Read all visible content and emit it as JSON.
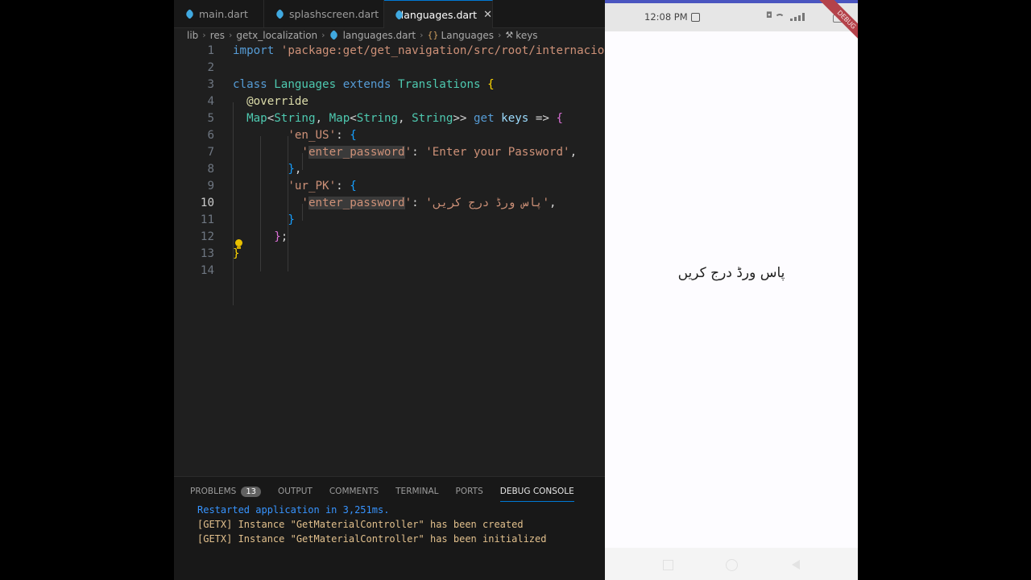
{
  "editor": {
    "tabs": [
      {
        "label": "main.dart",
        "active": false
      },
      {
        "label": "splashscreen.dart",
        "active": false
      },
      {
        "label": "languages.dart",
        "active": true
      }
    ],
    "close_glyph": "✕",
    "breadcrumbs": [
      "lib",
      "res",
      "getx_localization",
      "languages.dart",
      "Languages",
      "keys"
    ],
    "current_line": 10,
    "lines": [
      {
        "n": "1",
        "tokens": [
          [
            "kw",
            "import"
          ],
          [
            "pl",
            " "
          ],
          [
            "str",
            "'package:get/get_navigation/src/root/internacionalization.dart';"
          ]
        ]
      },
      {
        "n": "2",
        "tokens": []
      },
      {
        "n": "3",
        "tokens": [
          [
            "kw",
            "class"
          ],
          [
            "pl",
            " "
          ],
          [
            "ty",
            "Languages"
          ],
          [
            "pl",
            " "
          ],
          [
            "kw",
            "extends"
          ],
          [
            "pl",
            " "
          ],
          [
            "ty",
            "Translations"
          ],
          [
            "pl",
            " "
          ],
          [
            "br1",
            "{"
          ]
        ]
      },
      {
        "n": "4",
        "tokens": [
          [
            "pl",
            "  "
          ],
          [
            "fn",
            "@override"
          ]
        ]
      },
      {
        "n": "5",
        "tokens": [
          [
            "pl",
            "  "
          ],
          [
            "ty",
            "Map"
          ],
          [
            "pl",
            "<"
          ],
          [
            "ty",
            "String"
          ],
          [
            "pl",
            ", "
          ],
          [
            "ty",
            "Map"
          ],
          [
            "pl",
            "<"
          ],
          [
            "ty",
            "String"
          ],
          [
            "pl",
            ", "
          ],
          [
            "ty",
            "String"
          ],
          [
            "pl",
            ">> "
          ],
          [
            "kw",
            "get"
          ],
          [
            "pl",
            " "
          ],
          [
            "var",
            "keys"
          ],
          [
            "pl",
            " => "
          ],
          [
            "br2",
            "{"
          ]
        ]
      },
      {
        "n": "6",
        "tokens": [
          [
            "pl",
            "        "
          ],
          [
            "str",
            "'en_US'"
          ],
          [
            "pl",
            ": "
          ],
          [
            "br3",
            "{"
          ]
        ]
      },
      {
        "n": "7",
        "tokens": [
          [
            "pl",
            "          "
          ],
          [
            "str",
            "'enter_password'"
          ],
          [
            "pl",
            ": "
          ],
          [
            "str",
            "'Enter your Password'"
          ],
          [
            "pl",
            ","
          ]
        ]
      },
      {
        "n": "8",
        "tokens": [
          [
            "pl",
            "        "
          ],
          [
            "br3",
            "}"
          ],
          [
            "pl",
            ","
          ]
        ]
      },
      {
        "n": "9",
        "tokens": [
          [
            "pl",
            "        "
          ],
          [
            "str",
            "'ur_PK'"
          ],
          [
            "pl",
            ": "
          ],
          [
            "br3",
            "{"
          ]
        ]
      },
      {
        "n": "10",
        "tokens": [
          [
            "pl",
            "          "
          ],
          [
            "str",
            "'enter_password'"
          ],
          [
            "pl",
            ": "
          ],
          [
            "str",
            "'پاس ورڈ درج کریں'"
          ],
          [
            "pl",
            ","
          ]
        ]
      },
      {
        "n": "11",
        "tokens": [
          [
            "pl",
            "        "
          ],
          [
            "br3",
            "}"
          ]
        ]
      },
      {
        "n": "12",
        "tokens": [
          [
            "pl",
            "      "
          ],
          [
            "br2",
            "}"
          ],
          [
            "pl",
            ";"
          ]
        ]
      },
      {
        "n": "13",
        "tokens": [
          [
            "br1",
            "}"
          ]
        ]
      },
      {
        "n": "14",
        "tokens": []
      }
    ]
  },
  "panel": {
    "tabs": [
      {
        "label": "PROBLEMS",
        "badge": "13",
        "active": false
      },
      {
        "label": "OUTPUT",
        "active": false
      },
      {
        "label": "COMMENTS",
        "active": false
      },
      {
        "label": "TERMINAL",
        "active": false
      },
      {
        "label": "PORTS",
        "active": false
      },
      {
        "label": "DEBUG CONSOLE",
        "active": true
      }
    ],
    "logs": [
      "Restarted application in 3,251ms.",
      "[GETX] Instance \"GetMaterialController\" has been created",
      "[GETX] Instance \"GetMaterialController\" has been initialized"
    ]
  },
  "phone": {
    "time": "12:08 PM",
    "debug_banner": "DEBUG",
    "center_text": "پاس ورڈ درج کریں",
    "accent": "#4a55c0"
  },
  "colors": {
    "editor_bg": "#1f1f1f",
    "keyword": "#569cd6",
    "type": "#4ec9b0",
    "string": "#ce9178"
  }
}
